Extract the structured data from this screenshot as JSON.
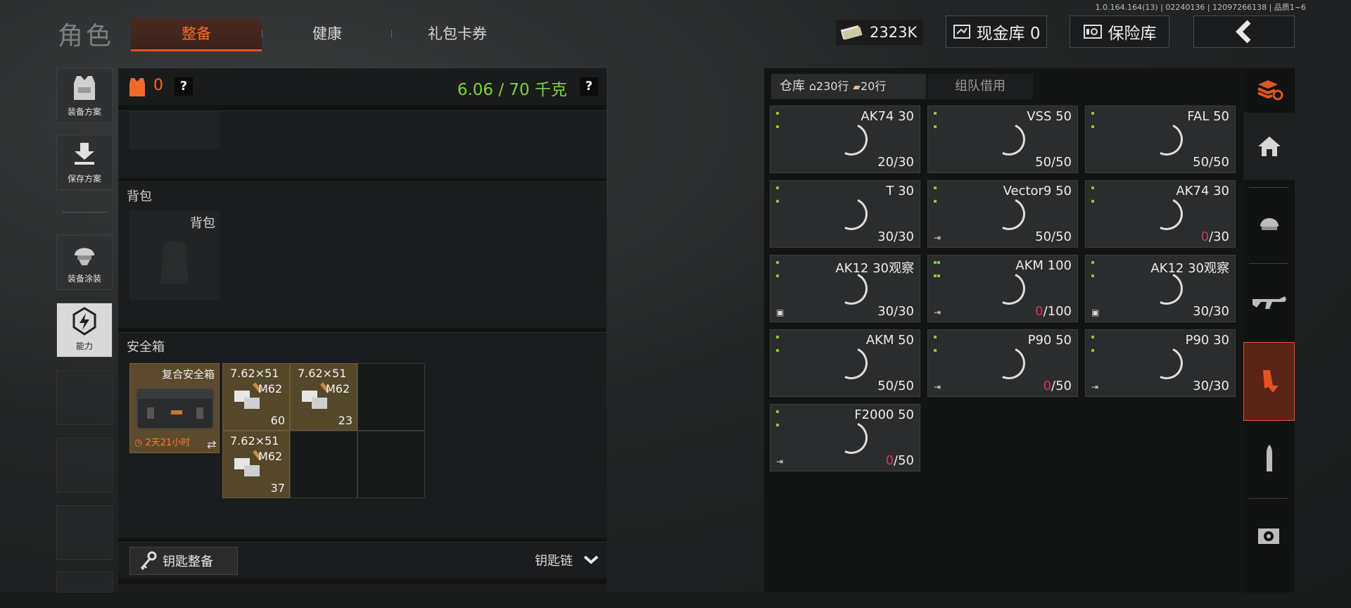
{
  "version": "1.0.164.164(13) | 02240136 | 12097266138 | 品质1~6",
  "title": "角色",
  "tabs": [
    {
      "label": "整备",
      "active": true
    },
    {
      "label": "健康",
      "active": false
    },
    {
      "label": "礼包卡券",
      "active": false
    }
  ],
  "topbar": {
    "money": "2323K",
    "cash_vault": "现金库 0",
    "insurance": "保险库",
    "back_icon": "chevron-left-icon"
  },
  "left_nav": [
    {
      "label": "装备方案",
      "icon": "vest-icon"
    },
    {
      "label": "保存方案",
      "icon": "download-icon"
    },
    {
      "label": "装备涂装",
      "icon": "helmet-icon"
    },
    {
      "label": "能力",
      "icon": "lightning-shield-icon"
    }
  ],
  "equipment": {
    "armor_count": "0",
    "help": "?",
    "weight": "6.06 / 70 千克",
    "weight_color": "#7cd33b",
    "backpack_title": "背包",
    "backpack_slot": "背包",
    "safe_box_title": "安全箱",
    "safe_box_name": "复合安全箱",
    "safe_box_timer": "2天21小时",
    "ammo": [
      {
        "caliber": "7.62×51",
        "type": "M62",
        "count": "60"
      },
      {
        "caliber": "7.62×51",
        "type": "M62",
        "count": "23"
      },
      {
        "caliber": "7.62×51",
        "type": "M62",
        "count": "37"
      }
    ],
    "key_button": "钥匙整备",
    "key_chain": "钥匙链"
  },
  "warehouse": {
    "tab_label": "仓库",
    "rows_home": "230行",
    "rows_ticket": "20行",
    "team_tab": "组队借用",
    "items": [
      {
        "name": "AK74 30",
        "count_red": "",
        "count": "20/30",
        "dots": 2,
        "corner": ""
      },
      {
        "name": "VSS 50",
        "count_red": "",
        "count": "50/50",
        "dots": 2,
        "corner": ""
      },
      {
        "name": "FAL 50",
        "count_red": "",
        "count": "50/50",
        "dots": 2,
        "corner": ""
      },
      {
        "name": "T 30",
        "count_red": "",
        "count": "30/30",
        "dots": 2,
        "corner": ""
      },
      {
        "name": "Vector9 50",
        "count_red": "",
        "count": "50/50",
        "dots": 2,
        "corner": "⇥"
      },
      {
        "name": "AK74 30",
        "count_red": "0",
        "count": "/30",
        "dots": 2,
        "corner": ""
      },
      {
        "name": "AK12 30观察",
        "count_red": "",
        "count": "30/30",
        "dots": 2,
        "corner": "▣"
      },
      {
        "name": "AKM 100",
        "count_red": "0",
        "count": "/100",
        "dots": 4,
        "corner": "⇥"
      },
      {
        "name": "AK12 30观察",
        "count_red": "",
        "count": "30/30",
        "dots": 2,
        "corner": "▣"
      },
      {
        "name": "AKM 50",
        "count_red": "",
        "count": "50/50",
        "dots": 2,
        "corner": ""
      },
      {
        "name": "P90 50",
        "count_red": "0",
        "count": "/50",
        "dots": 2,
        "corner": "⇥"
      },
      {
        "name": "P90 30",
        "count_red": "",
        "count": "30/30",
        "dots": 2,
        "corner": "⇥"
      },
      {
        "name": "F2000 50",
        "count_red": "0",
        "count": "/50",
        "dots": 2,
        "corner": "⇥"
      }
    ]
  },
  "right_nav": [
    {
      "icon": "layers-refresh-icon"
    },
    {
      "icon": "home-icon"
    },
    {
      "icon": "helmet-icon"
    },
    {
      "icon": "rifle-icon"
    },
    {
      "icon": "magazine-icon",
      "selected": true
    },
    {
      "icon": "bullet-icon"
    },
    {
      "icon": "scope-icon"
    }
  ]
}
